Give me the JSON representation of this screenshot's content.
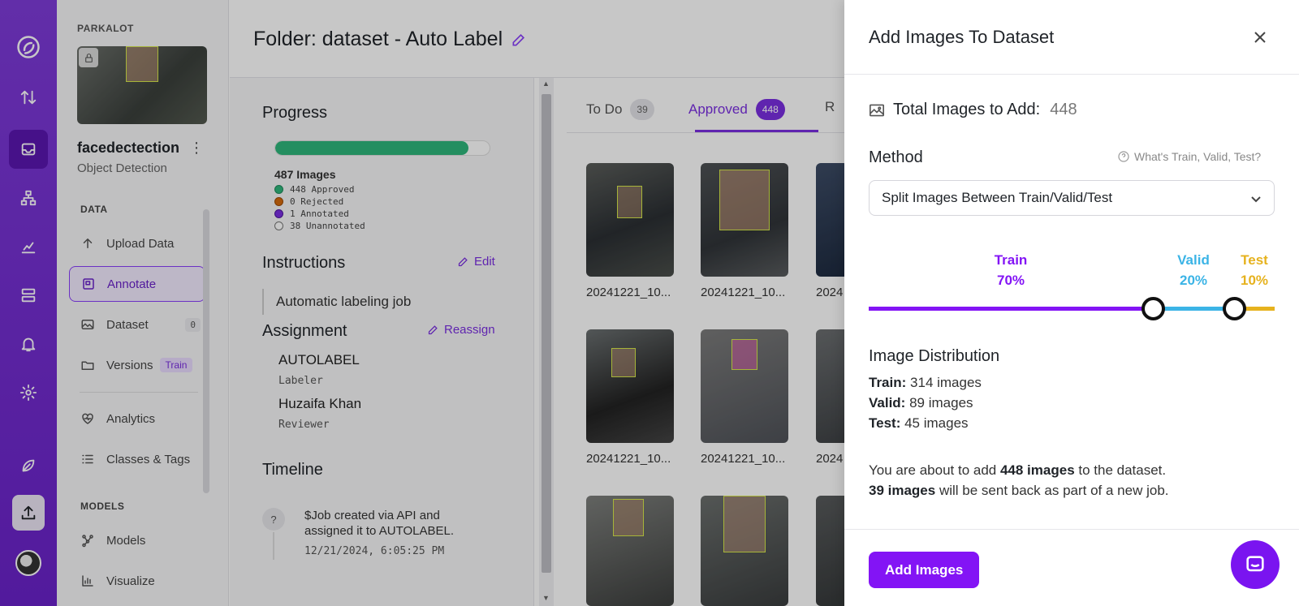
{
  "rail": {
    "icons": [
      "logo-icon",
      "sort-arrows-icon",
      "inbox-icon",
      "workflow-icon",
      "chart-icon",
      "server-icon",
      "bell-icon",
      "gear-icon",
      "leaf-icon",
      "upload-icon"
    ]
  },
  "sidebar": {
    "workspace": "PARKALOT",
    "project_name": "facedectection",
    "project_type": "Object Detection",
    "data_section": "DATA",
    "models_section": "MODELS",
    "items": [
      {
        "label": "Upload Data"
      },
      {
        "label": "Annotate"
      },
      {
        "label": "Dataset",
        "count": "0"
      },
      {
        "label": "Versions",
        "pill": "Train"
      },
      {
        "label": "Analytics"
      },
      {
        "label": "Classes & Tags"
      },
      {
        "label": "Models"
      },
      {
        "label": "Visualize"
      }
    ]
  },
  "main": {
    "title": "Folder: dataset - Auto Label",
    "progress": {
      "heading": "Progress",
      "fraction": 0.9,
      "total": "487 Images",
      "approved": "448 Approved",
      "rejected": "0 Rejected",
      "annotated": "1 Annotated",
      "unannotated": "38 Unannotated"
    },
    "instructions": {
      "heading": "Instructions",
      "edit": "Edit",
      "text": "Automatic labeling job"
    },
    "assignment": {
      "heading": "Assignment",
      "reassign": "Reassign",
      "labeler_name": "AUTOLABEL",
      "labeler_role": "Labeler",
      "reviewer_name": "Huzaifa Khan",
      "reviewer_role": "Reviewer"
    },
    "timeline": {
      "heading": "Timeline",
      "marker": "?",
      "text": "$Job created via API and assigned it to AUTOLABEL.",
      "date": "12/21/2024, 6:05:25 PM"
    },
    "tabs": [
      {
        "label": "To Do",
        "count": "39"
      },
      {
        "label": "Approved",
        "count": "448"
      },
      {
        "label": "R"
      }
    ],
    "image_caption": "20241221_10...",
    "image_caption_cut": "2024"
  },
  "drawer": {
    "title": "Add Images To Dataset",
    "total_label": "Total Images to Add:",
    "total_value": "448",
    "method_label": "Method",
    "help_text": "What's Train, Valid, Test?",
    "method_value": "Split Images Between Train/Valid/Test",
    "split": {
      "train_label": "Train",
      "train_pct": "70%",
      "train": 70,
      "valid_label": "Valid",
      "valid_pct": "20%",
      "valid": 20,
      "test_label": "Test",
      "test_pct": "10%",
      "test": 10
    },
    "distribution_title": "Image Distribution",
    "dist": [
      {
        "key": "Train:",
        "value": "314 images"
      },
      {
        "key": "Valid:",
        "value": "89 images"
      },
      {
        "key": "Test:",
        "value": "45 images"
      }
    ],
    "summary_pre": "You are about to add ",
    "summary_bold": "448 images",
    "summary_post": " to the dataset.",
    "summary2_bold": "39 images",
    "summary2_post": " will be sent back as part of a new job.",
    "add_button": "Add Images"
  },
  "colors": {
    "brand": "#7a2fe0",
    "train": "#8314f5",
    "valid": "#3bb4e6",
    "test": "#e6b21e",
    "progress": "#2fb67c"
  }
}
